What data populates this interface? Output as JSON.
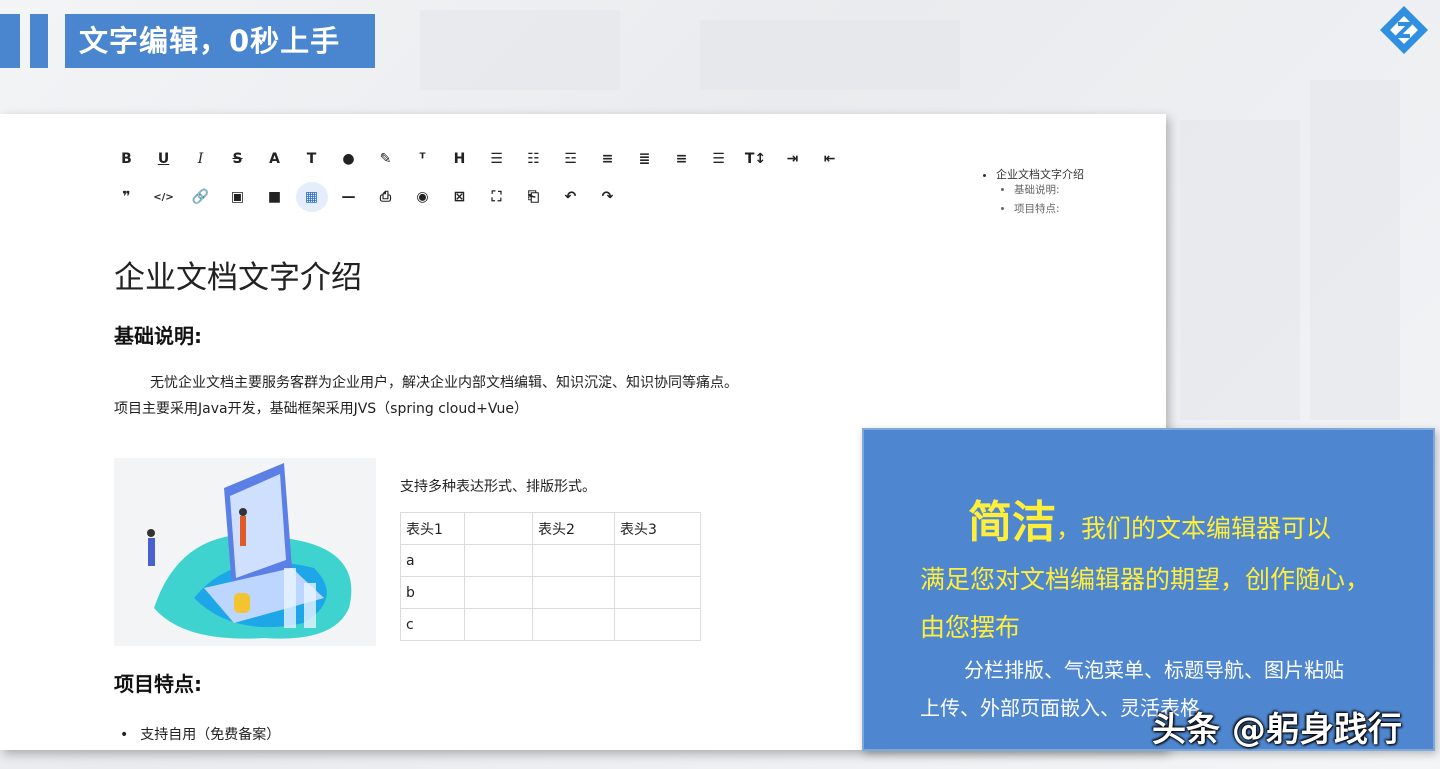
{
  "header": {
    "title": "文字编辑，0秒上手"
  },
  "toolbar": {
    "row1": [
      {
        "name": "bold",
        "glyph": "B"
      },
      {
        "name": "underline",
        "glyph": "U"
      },
      {
        "name": "italic",
        "glyph": "I"
      },
      {
        "name": "strikethrough",
        "glyph": "S"
      },
      {
        "name": "font-color",
        "glyph": "A"
      },
      {
        "name": "clear-format",
        "glyph": "T"
      },
      {
        "name": "background-color",
        "glyph": "●"
      },
      {
        "name": "highlight",
        "glyph": "✎"
      },
      {
        "name": "remove-format",
        "glyph": "ᵀ"
      },
      {
        "name": "heading",
        "glyph": "H"
      },
      {
        "name": "unordered-list",
        "glyph": "☰"
      },
      {
        "name": "ordered-list",
        "glyph": "☷"
      },
      {
        "name": "task-list",
        "glyph": "☲"
      },
      {
        "name": "align-left",
        "glyph": "≡"
      },
      {
        "name": "align-center",
        "glyph": "≣"
      },
      {
        "name": "align-right",
        "glyph": "≡"
      },
      {
        "name": "justify",
        "glyph": "☰"
      },
      {
        "name": "font-size",
        "glyph": "T↕"
      },
      {
        "name": "indent",
        "glyph": "⇥"
      },
      {
        "name": "outdent",
        "glyph": "⇤"
      }
    ],
    "row2": [
      {
        "name": "quote",
        "glyph": "❞"
      },
      {
        "name": "code",
        "glyph": "</>"
      },
      {
        "name": "link",
        "glyph": "🔗"
      },
      {
        "name": "image",
        "glyph": "▣"
      },
      {
        "name": "video",
        "glyph": "■"
      },
      {
        "name": "table",
        "glyph": "▦",
        "active": true
      },
      {
        "name": "horizontal-rule",
        "glyph": "—"
      },
      {
        "name": "print",
        "glyph": "⎙"
      },
      {
        "name": "preview",
        "glyph": "◉"
      },
      {
        "name": "embed",
        "glyph": "⊠"
      },
      {
        "name": "fullscreen",
        "glyph": "⛶"
      },
      {
        "name": "export",
        "glyph": "⎗"
      },
      {
        "name": "undo",
        "glyph": "↶"
      },
      {
        "name": "redo",
        "glyph": "↷"
      }
    ]
  },
  "toc": {
    "title": "企业文档文字介绍",
    "items": [
      "基础说明:",
      "项目特点:"
    ]
  },
  "document": {
    "title": "企业文档文字介绍",
    "section1_heading": "基础说明:",
    "para1": "无忧企业文档主要服务客群为企业用户，解决企业内部文档编辑、知识沉淀、知识协同等痛点。",
    "para2": "项目主要采用Java开发，基础框架采用JVS（spring cloud+Vue）",
    "caption": "支持多种表达形式、排版形式。",
    "table": {
      "headers": [
        "表头1",
        "",
        "表头2",
        "表头3"
      ],
      "rows": [
        [
          "a",
          "",
          "",
          ""
        ],
        [
          "b",
          "",
          "",
          ""
        ],
        [
          "c",
          "",
          "",
          ""
        ]
      ]
    },
    "section2_heading": "项目特点:",
    "bullet1": "支持自用（免费备案）"
  },
  "callout": {
    "big": "简洁",
    "line1_rest": "，我们的文本编辑器可以",
    "line2": "满足您对文档编辑器的期望，创作随心，",
    "line3": "由您摆布",
    "line4": "分栏排版、气泡菜单、标题导航、图片粘贴",
    "line5": "上传、外部页面嵌入、灵活表格"
  },
  "watermark": "头条 @躬身践行",
  "colors": {
    "brand_blue": "#4a86d0",
    "callout_blue": "#4e86cf",
    "highlight_yellow": "#ffef3a"
  }
}
